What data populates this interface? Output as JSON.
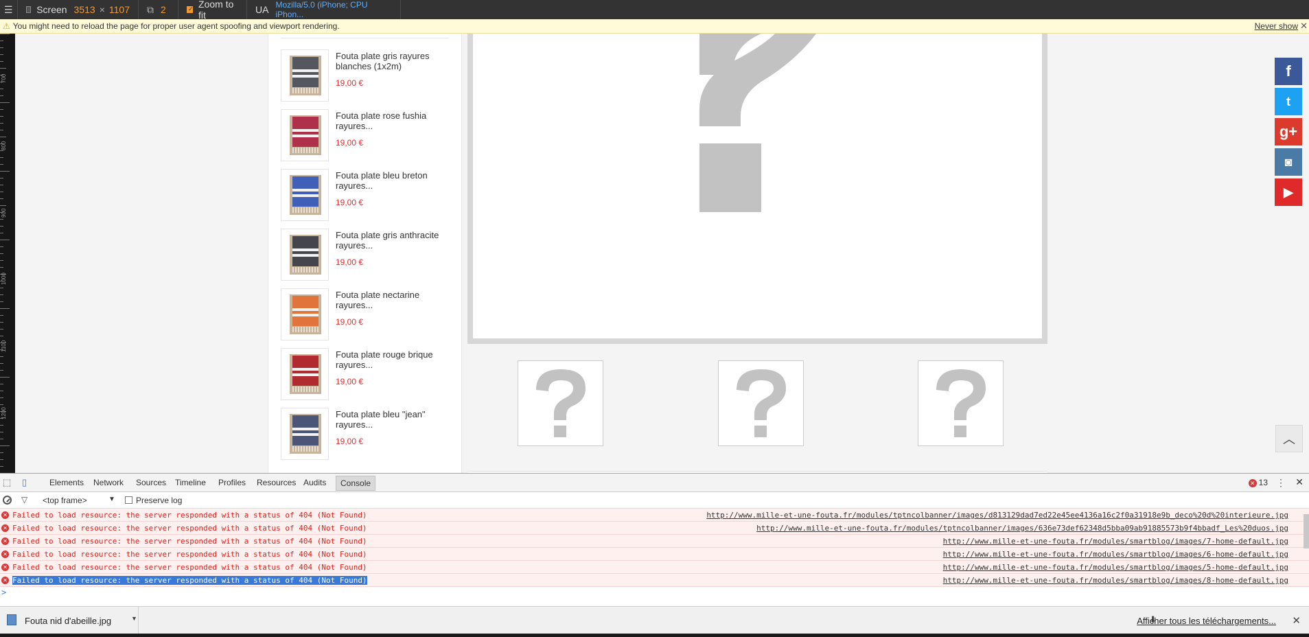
{
  "emulation": {
    "screen_label": "Screen",
    "screen_width": "3513",
    "times": "×",
    "screen_height": "1107",
    "dpr": "2",
    "zoom_label": "Zoom to fit",
    "ua_label": "UA",
    "ua_value": "Mozilla/5.0 (iPhone; CPU iPhon..."
  },
  "warning": {
    "text": "You might need to reload the page for proper user agent spoofing and viewport rendering.",
    "never_show": "Never show"
  },
  "ruler_labels": [
    "700",
    "800",
    "900",
    "1000",
    "1100",
    "1200"
  ],
  "products": [
    {
      "name": "Fouta plate gris rayures blanches (1x2m)",
      "price": "19,00 €",
      "color": "#55575e"
    },
    {
      "name": "Fouta plate rose fushia rayures...",
      "price": "19,00 €",
      "color": "#b0304c"
    },
    {
      "name": "Fouta plate bleu breton rayures...",
      "price": "19,00 €",
      "color": "#3f5fb8"
    },
    {
      "name": "Fouta plate gris anthracite rayures...",
      "price": "19,00 €",
      "color": "#45464b"
    },
    {
      "name": "Fouta plate nectarine rayures...",
      "price": "19,00 €",
      "color": "#e0743a"
    },
    {
      "name": "Fouta plate rouge brique rayures...",
      "price": "19,00 €",
      "color": "#b02a30"
    },
    {
      "name": "Fouta plate bleu \"jean\" rayures...",
      "price": "19,00 €",
      "color": "#4a5578"
    }
  ],
  "social": [
    {
      "name": "facebook",
      "glyph": "f",
      "color": "#3b5998"
    },
    {
      "name": "twitter",
      "glyph": "t",
      "color": "#1da1f2"
    },
    {
      "name": "google-plus",
      "glyph": "g+",
      "color": "#dd3a2e"
    },
    {
      "name": "instagram",
      "glyph": "◙",
      "color": "#4a7aa6"
    },
    {
      "name": "youtube",
      "glyph": "▶",
      "color": "#e02a2a"
    }
  ],
  "devtools": {
    "tabs": [
      "Elements",
      "Network",
      "Sources",
      "Timeline",
      "Profiles",
      "Resources",
      "Audits",
      "Console"
    ],
    "active_tab": "Console",
    "error_count": "13",
    "frame": "<top frame>",
    "preserve_log": "Preserve log",
    "messages": [
      {
        "text": "Failed to load resource: the server responded with a status of 404 (Not Found)",
        "url": "http://www.mille-et-une-fouta.fr/modules/tptncolbanner/images/d813129dad7ed22e45ee4136a16c2f0a31918e9b_deco%20d%20interieure.jpg"
      },
      {
        "text": "Failed to load resource: the server responded with a status of 404 (Not Found)",
        "url": "http://www.mille-et-une-fouta.fr/modules/tptncolbanner/images/636e73def62348d5bba09ab91885573b9f4bbadf_Les%20duos.jpg"
      },
      {
        "text": "Failed to load resource: the server responded with a status of 404 (Not Found)",
        "url": "http://www.mille-et-une-fouta.fr/modules/smartblog/images/7-home-default.jpg"
      },
      {
        "text": "Failed to load resource: the server responded with a status of 404 (Not Found)",
        "url": "http://www.mille-et-une-fouta.fr/modules/smartblog/images/6-home-default.jpg"
      },
      {
        "text": "Failed to load resource: the server responded with a status of 404 (Not Found)",
        "url": "http://www.mille-et-une-fouta.fr/modules/smartblog/images/5-home-default.jpg"
      },
      {
        "text": "Failed to load resource: the server responded with a status of 404 (Not Found)",
        "url": "http://www.mille-et-une-fouta.fr/modules/smartblog/images/8-home-default.jpg"
      }
    ],
    "prompt": ">"
  },
  "downloads": {
    "file": "Fouta nid d'abeille.jpg",
    "show_all": "Afficher tous les téléchargements..."
  }
}
